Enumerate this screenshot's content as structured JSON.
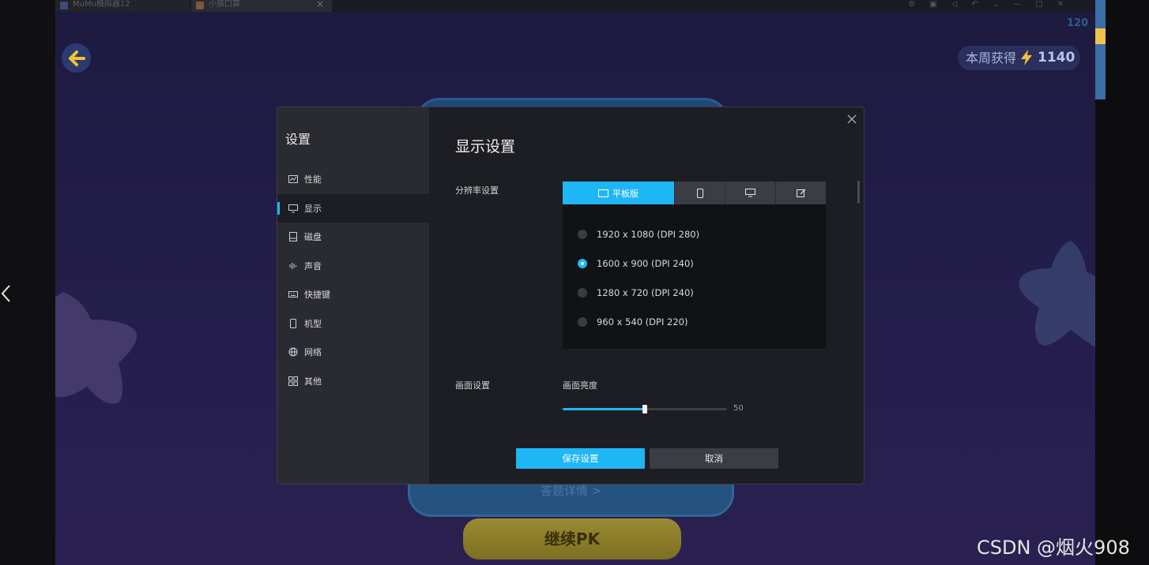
{
  "host_tabs": {
    "tab1": "MuMu模拟器12",
    "tab2": "小猿口算"
  },
  "game": {
    "fps": "120",
    "week_label": "本周获得",
    "week_value": "1140",
    "answer_detail": "答题详情 >",
    "continue_pk": "继续PK"
  },
  "dialog": {
    "sidebar_title": "设置",
    "sidebar_items": [
      {
        "label": "性能",
        "icon": "performance-icon"
      },
      {
        "label": "显示",
        "icon": "display-icon"
      },
      {
        "label": "磁盘",
        "icon": "disk-icon"
      },
      {
        "label": "声音",
        "icon": "sound-icon"
      },
      {
        "label": "快捷键",
        "icon": "keyboard-icon"
      },
      {
        "label": "机型",
        "icon": "phone-model-icon"
      },
      {
        "label": "网络",
        "icon": "network-icon"
      },
      {
        "label": "其他",
        "icon": "other-icon"
      }
    ],
    "active_item": "显示",
    "main_title": "显示设置",
    "resolution_label": "分辨率设置",
    "tabs": {
      "tablet": "平板版"
    },
    "resolutions": [
      {
        "label": "1920 x 1080 (DPI 280)",
        "selected": false
      },
      {
        "label": "1600 x 900 (DPI 240)",
        "selected": true
      },
      {
        "label": "1280 x 720 (DPI 240)",
        "selected": false
      },
      {
        "label": "960 x 540 (DPI 220)",
        "selected": false
      }
    ],
    "screen_label": "画面设置",
    "brightness_label": "画面亮度",
    "brightness_value": "50",
    "brightness_max": 100,
    "save_label": "保存设置",
    "cancel_label": "取消"
  },
  "watermark": "CSDN @烟火908",
  "colors": {
    "accent": "#1fb6f5",
    "dialog_bg": "#1d1e23",
    "sidebar_bg": "#2a2b31"
  }
}
